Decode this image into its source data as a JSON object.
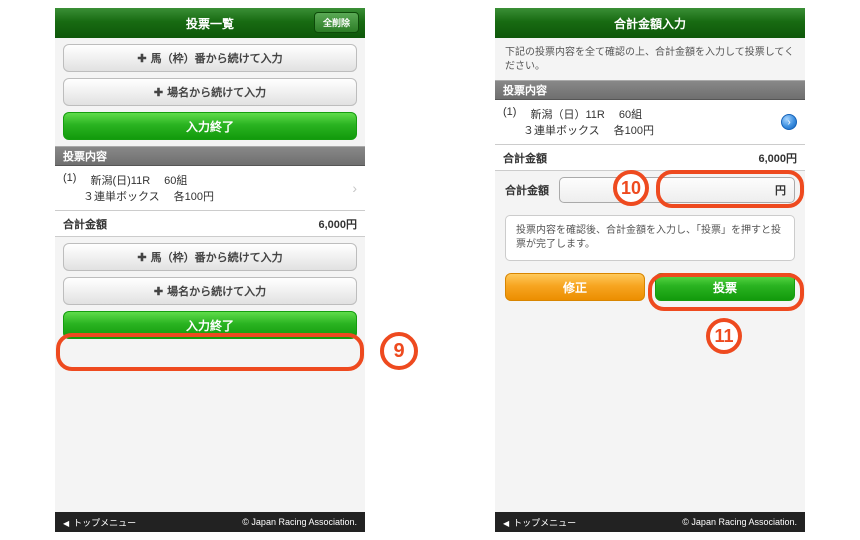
{
  "left": {
    "header_title": "投票一覧",
    "header_pill": "全削除",
    "btn_horse": "馬（枠）番から続けて入力",
    "btn_place": "場名から続けて入力",
    "btn_finish": "入力終了",
    "sect_contents": "投票内容",
    "row1": {
      "idx": "(1)",
      "track": "新潟(日)11R",
      "combo": "60組",
      "type": "３連単ボックス",
      "unit": "各100円"
    },
    "total_label": "合計金額",
    "total_value": "6,000円",
    "btn_horse2": "馬（枠）番から続けて入力",
    "btn_place2": "場名から続けて入力",
    "btn_finish2": "入力終了",
    "footer_menu": "トップメニュー",
    "footer_copy": "© Japan Racing Association."
  },
  "right": {
    "header_title": "合計金額入力",
    "note": "下記の投票内容を全て確認の上、合計金額を入力して投票してください。",
    "sect_contents": "投票内容",
    "row1": {
      "idx": "(1)",
      "track": "新潟（日）11R",
      "combo": "60組",
      "type": "３連単ボックス",
      "unit": "各100円"
    },
    "total_label": "合計金額",
    "total_value": "6,000円",
    "amount_label": "合計金額",
    "amount_unit": "円",
    "amount_placeholder": "",
    "info": "投票内容を確認後、合計金額を入力し、「投票」を押すと投票が完了します。",
    "btn_fix": "修正",
    "btn_vote": "投票",
    "footer_menu": "トップメニュー",
    "footer_copy": "© Japan Racing Association."
  },
  "callouts": {
    "n9": "9",
    "n10": "10",
    "n11": "11"
  }
}
